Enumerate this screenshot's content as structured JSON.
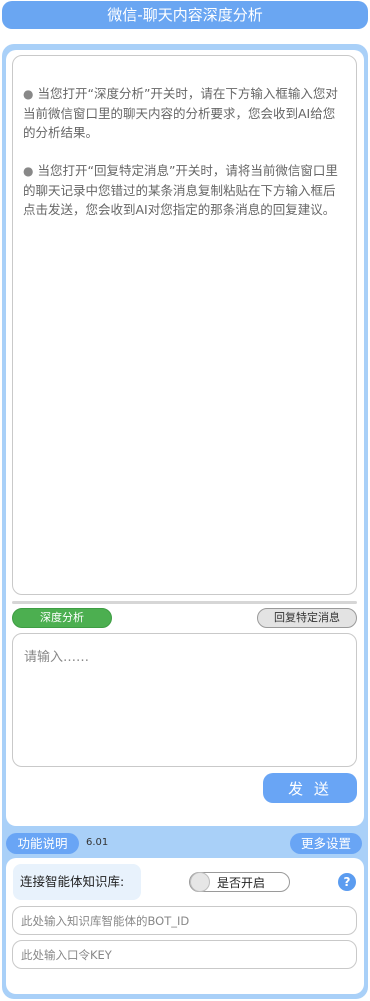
{
  "header": {
    "title": "微信-聊天内容深度分析"
  },
  "output": {
    "paragraphs": [
      "当您打开“深度分析”开关时，请在下方输入框输入您对当前微信窗口里的聊天内容的分析要求，您会收到AI给您的分析结果。",
      "当您打开“回复特定消息”开关时，请将当前微信窗口里的聊天记录中您错过的某条消息复制粘贴在下方输入框后点击发送，您会收到AI对您指定的那条消息的回复建议。"
    ],
    "bullet": "●"
  },
  "modes": {
    "deep_label": "深度分析",
    "reply_label": "回复特定消息"
  },
  "input": {
    "placeholder": "请输入……",
    "value": ""
  },
  "send": {
    "label": "发 送"
  },
  "footer": {
    "help_label": "功能说明",
    "version": "6.01",
    "more_label": "更多设置"
  },
  "knowledge_base": {
    "label": "连接智能体知识库:",
    "toggle_label": "是否开启",
    "toggle_on": false,
    "help_icon": "?",
    "bot_id_placeholder": "此处输入知识库智能体的BOT_ID",
    "key_placeholder": "此处输入口令KEY"
  },
  "colors": {
    "accent": "#69a5f5",
    "frame": "#a9d0f8",
    "deep_mode": "#4caf50",
    "reply_mode": "#e3e3e3"
  }
}
